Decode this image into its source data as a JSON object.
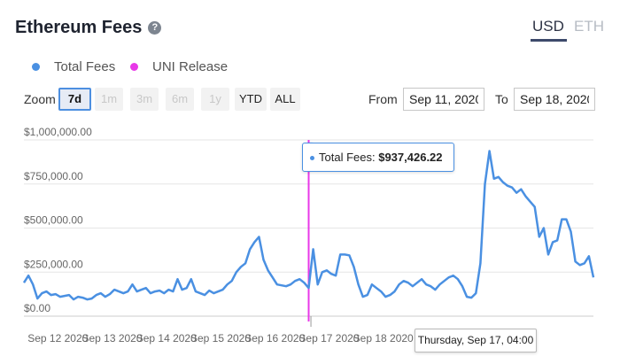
{
  "header": {
    "title": "Ethereum Fees",
    "help_icon": "question-circle-icon"
  },
  "currency": {
    "options": [
      "USD",
      "ETH"
    ],
    "selected": "USD"
  },
  "legend": [
    {
      "label": "Total Fees",
      "color": "#4a90e2"
    },
    {
      "label": "UNI Release",
      "color": "#e838e8"
    }
  ],
  "zoom": {
    "label": "Zoom",
    "buttons": [
      "7d",
      "1m",
      "3m",
      "6m",
      "1y",
      "YTD",
      "ALL"
    ],
    "active": "7d"
  },
  "range": {
    "from_label": "From",
    "from_value": "Sep 11, 2020",
    "to_label": "To",
    "to_value": "Sep 18, 2020"
  },
  "tooltip": {
    "series": "Total Fees:",
    "value": "$937,426.22"
  },
  "crosshair_label": "Thursday, Sep 17, 04:00",
  "chart_data": {
    "type": "line",
    "title": "Ethereum Fees",
    "xlabel": "",
    "ylabel": "",
    "ylim": [
      0,
      1000000
    ],
    "yticks": [
      "$0.00",
      "$250,000.00",
      "$500,000.00",
      "$750,000.00",
      "$1,000,000.00"
    ],
    "xticks": [
      "Sep 12 2020",
      "Sep 13 2020",
      "Sep 14 2020",
      "Sep 15 2020",
      "Sep 16 2020",
      "Sep 17 2020",
      "Sep 18 2020"
    ],
    "grid": true,
    "x_start": "Sep 11 2020 21:00",
    "x_step_hours": 2,
    "series": [
      {
        "name": "Total Fees",
        "color": "#4a90e2",
        "values": [
          190000,
          230000,
          180000,
          100000,
          130000,
          140000,
          120000,
          125000,
          110000,
          115000,
          120000,
          95000,
          110000,
          105000,
          95000,
          100000,
          120000,
          130000,
          110000,
          125000,
          150000,
          140000,
          130000,
          140000,
          180000,
          140000,
          150000,
          160000,
          130000,
          140000,
          145000,
          130000,
          150000,
          140000,
          210000,
          150000,
          160000,
          210000,
          140000,
          130000,
          120000,
          145000,
          130000,
          140000,
          150000,
          180000,
          200000,
          250000,
          280000,
          300000,
          380000,
          420000,
          450000,
          320000,
          260000,
          220000,
          180000,
          175000,
          170000,
          180000,
          200000,
          210000,
          190000,
          160000,
          380000,
          180000,
          250000,
          260000,
          240000,
          230000,
          350000,
          350000,
          345000,
          280000,
          180000,
          110000,
          120000,
          180000,
          160000,
          140000,
          110000,
          120000,
          140000,
          180000,
          200000,
          190000,
          170000,
          190000,
          210000,
          180000,
          170000,
          150000,
          180000,
          200000,
          220000,
          230000,
          210000,
          170000,
          110000,
          105000,
          130000,
          300000,
          750000,
          937426,
          780000,
          790000,
          760000,
          740000,
          730000,
          700000,
          720000,
          680000,
          650000,
          620000,
          450000,
          500000,
          350000,
          420000,
          430000,
          550000,
          550000,
          480000,
          310000,
          290000,
          300000,
          340000,
          220000
        ]
      }
    ],
    "markers": [
      {
        "name": "UNI Release",
        "x": "Sep 17 2020 03:00",
        "color": "#e838e8"
      }
    ],
    "highlight": {
      "x": "Sep 17 2020 04:00",
      "value": 937426.22
    }
  }
}
